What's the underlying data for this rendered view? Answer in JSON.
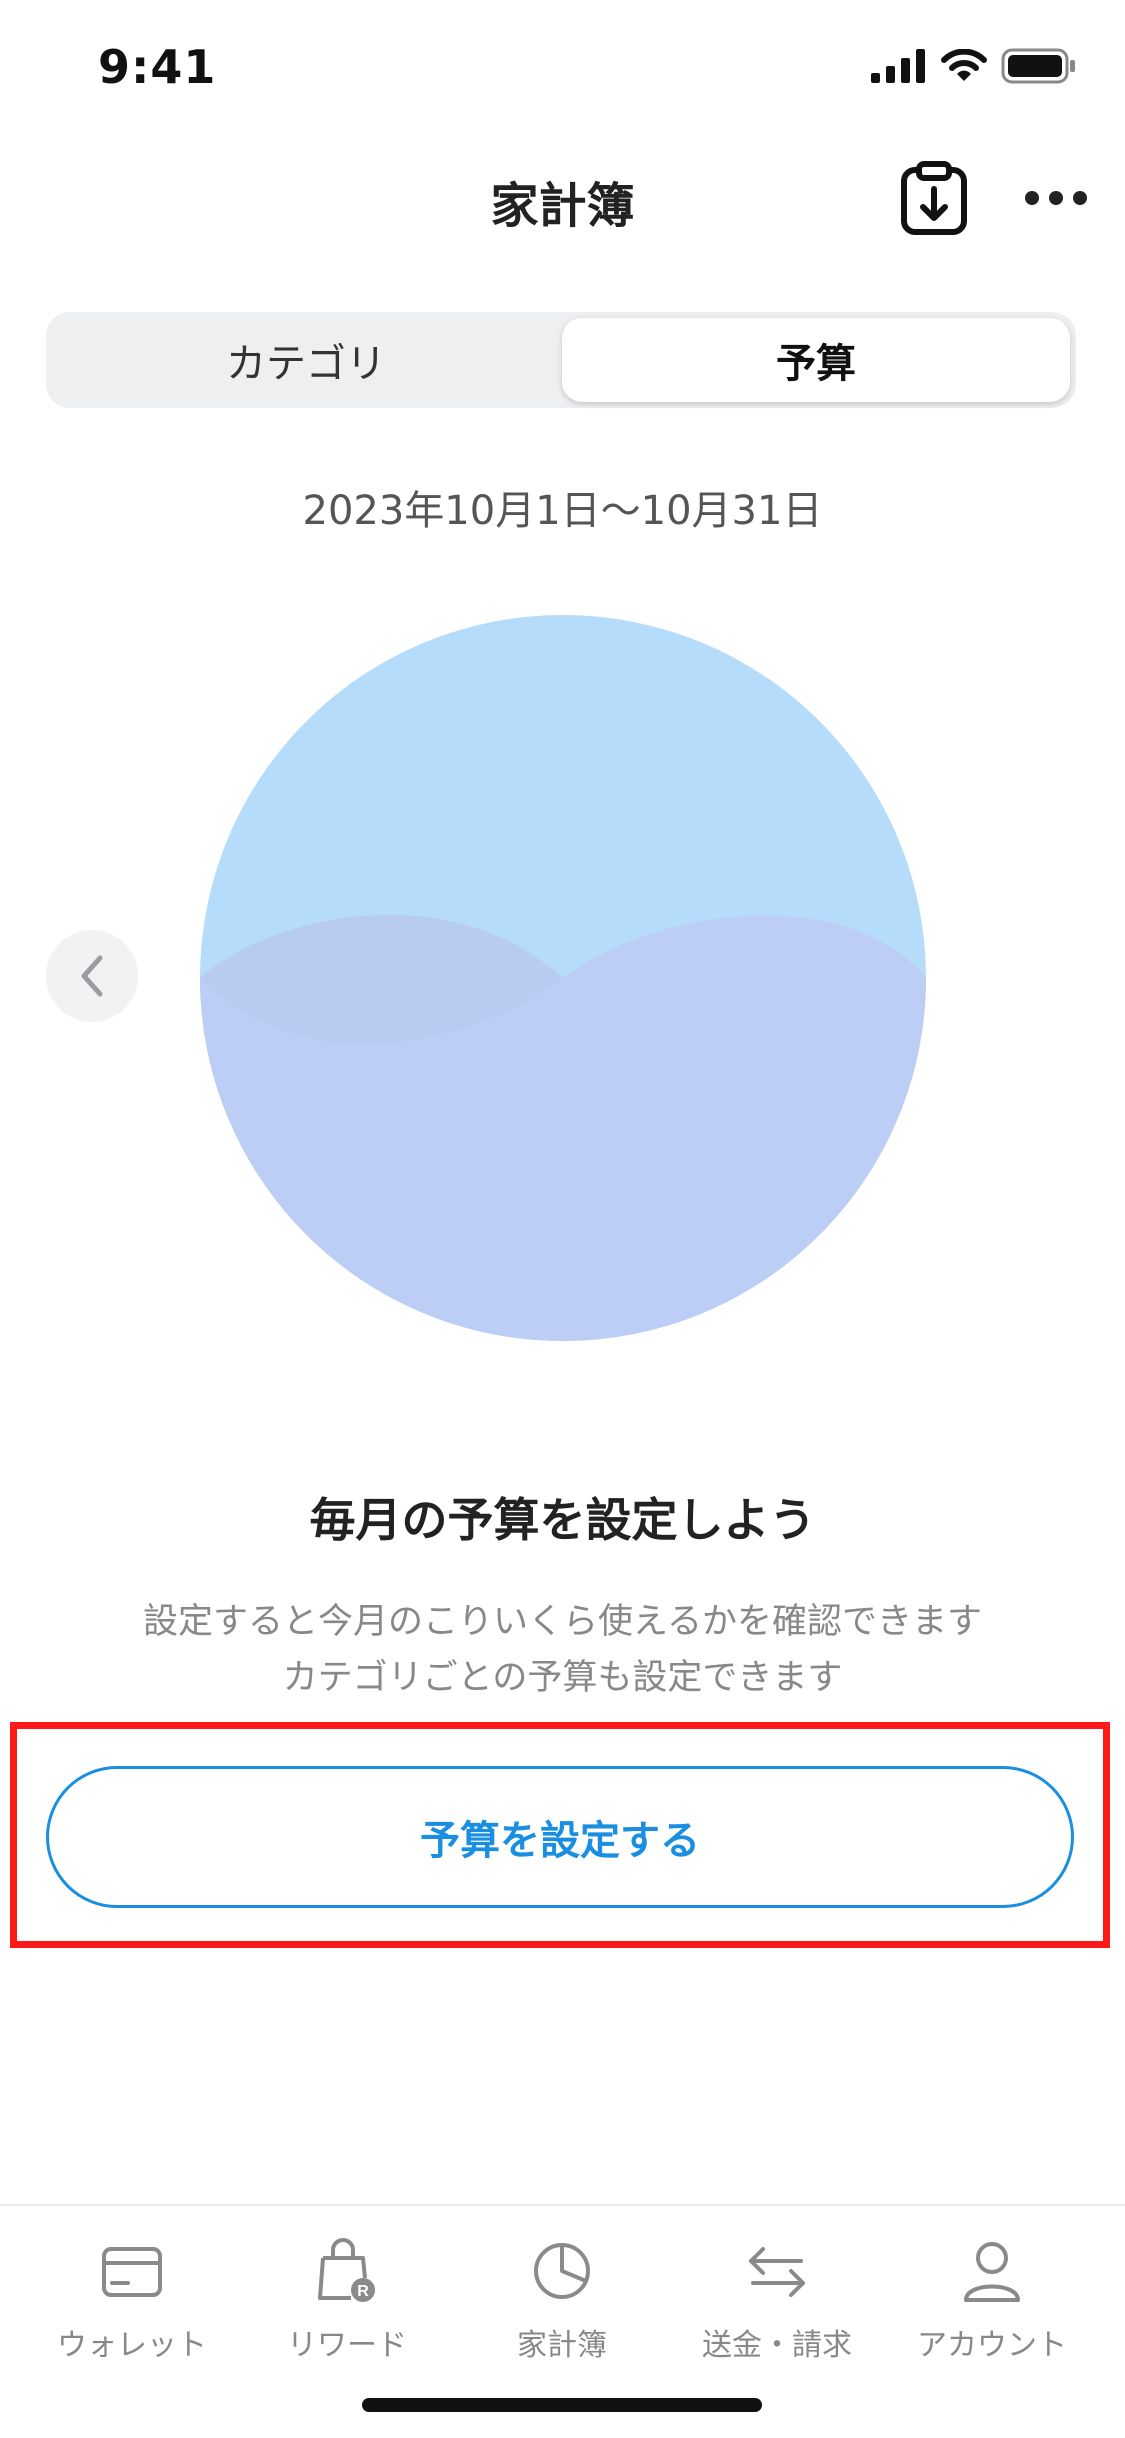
{
  "status": {
    "time": "9:41"
  },
  "header": {
    "title": "家計簿"
  },
  "segments": [
    "カテゴリ",
    "予算"
  ],
  "period": "2023年10月1日〜10月31日",
  "empty_state": {
    "heading": "毎月の予算を設定しよう",
    "line1": "設定すると今月のこりいくら使えるかを確認できます",
    "line2": "カテゴリごとの予算も設定できます",
    "cta": "予算を設定する"
  },
  "tabbar": [
    {
      "label": "ウォレット",
      "icon": "wallet-icon"
    },
    {
      "label": "リワード",
      "icon": "reward-bag-icon"
    },
    {
      "label": "家計簿",
      "icon": "pie-chart-icon"
    },
    {
      "label": "送金・請求",
      "icon": "transfer-arrows-icon"
    },
    {
      "label": "アカウント",
      "icon": "person-icon"
    }
  ],
  "colors": {
    "accent": "#1a8ee0",
    "highlight": "#ff1a1a",
    "wave_back": "#b6dcfb",
    "wave_front": "#bccef5"
  }
}
